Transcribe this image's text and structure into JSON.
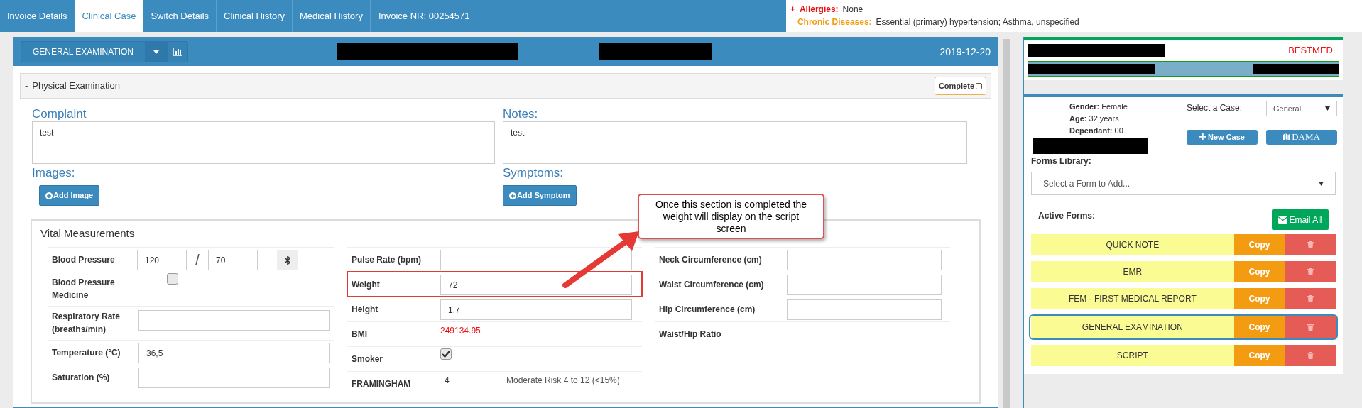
{
  "tabs": [
    {
      "label": "Invoice Details",
      "selected": false
    },
    {
      "label": "Clinical Case",
      "selected": true
    },
    {
      "label": "Switch Details",
      "selected": false
    },
    {
      "label": "Clinical History",
      "selected": false
    },
    {
      "label": "Medical History",
      "selected": false
    }
  ],
  "invoice_nr": "Invoice NR: 00254571",
  "alerts": {
    "toggle": "+",
    "items": [
      {
        "kind": "allergy",
        "label": "Allergies:",
        "value": "None"
      },
      {
        "kind": "chronic",
        "label": "Chronic Diseases:",
        "value": "Essential (primary) hypertension; Asthma, unspecified"
      }
    ]
  },
  "main": {
    "form_title": "GENERAL EXAMINATION",
    "date": "2019-12-20",
    "section": {
      "toggle": "-",
      "title": "Physical Examination",
      "complete_label": "Complete",
      "complete_checked": false
    },
    "complaint": {
      "label": "Complaint",
      "value": "test"
    },
    "notes": {
      "label": "Notes:",
      "value": "test"
    },
    "images": {
      "label": "Images:",
      "button": "Add Image"
    },
    "symptoms": {
      "label": "Symptoms:",
      "button": "Add Symptom"
    },
    "vitals": {
      "title": "Vital Measurements",
      "columns": [
        [
          {
            "kind": "bp",
            "label": "Blood Pressure",
            "value": "120",
            "value2": "70",
            "separator": "/"
          },
          {
            "kind": "checkbox",
            "label": "Blood Pressure Medicine",
            "checked": false
          },
          {
            "kind": "input",
            "label": "Respiratory Rate (breaths/min)"
          },
          {
            "kind": "input",
            "label": "Temperature (°C)",
            "value": "36,5"
          },
          {
            "kind": "input",
            "label": "Saturation (%)"
          }
        ],
        [
          {
            "kind": "input",
            "label": "Pulse Rate (bpm)"
          },
          {
            "kind": "input",
            "label": "Weight",
            "value": "72",
            "highlighted": true
          },
          {
            "kind": "input",
            "label": "Height",
            "value": "1,7"
          },
          {
            "kind": "reading",
            "label": "BMI",
            "value": "249134.95"
          },
          {
            "kind": "checkbox",
            "label": "Smoker",
            "checked": true
          },
          {
            "kind": "score",
            "label": "FRAMINGHAM",
            "value": "4",
            "note": "Moderate Risk 4 to 12 (<15%)"
          }
        ],
        [
          {
            "kind": "input",
            "label": "Neck Circumference (cm)"
          },
          {
            "kind": "input",
            "label": "Waist Circumference (cm)"
          },
          {
            "kind": "input",
            "label": "Hip Circumference (cm)"
          },
          {
            "kind": "reading",
            "label": "Waist/Hip Ratio"
          }
        ]
      ]
    }
  },
  "callout": {
    "text": "Once this section is completed the weight will display on the script screen"
  },
  "side": {
    "insurer": "BESTMED",
    "patient": [
      "**Gender:** Female",
      "**Age:** 32 years",
      "**Dependant:** 00"
    ],
    "select_case": {
      "label": "Select a Case:",
      "value": "General"
    },
    "buttons": [
      {
        "kind": "new",
        "label": "New Case"
      },
      {
        "kind": "map",
        "label": "DAMA"
      }
    ],
    "forms_library": {
      "label": "Forms Library:",
      "placeholder": "Select a Form to Add..."
    },
    "active_forms": {
      "label": "Active Forms:",
      "email_button": "Email All",
      "forms": [
        {
          "name": "QUICK NOTE",
          "copy": "Copy",
          "selected": false
        },
        {
          "name": "EMR",
          "copy": "Copy",
          "selected": false
        },
        {
          "name": "FEM - FIRST MEDICAL REPORT",
          "copy": "Copy",
          "selected": false
        },
        {
          "name": "GENERAL EXAMINATION",
          "copy": "Copy",
          "selected": true
        },
        {
          "name": "SCRIPT",
          "copy": "Copy",
          "selected": false
        }
      ]
    }
  }
}
